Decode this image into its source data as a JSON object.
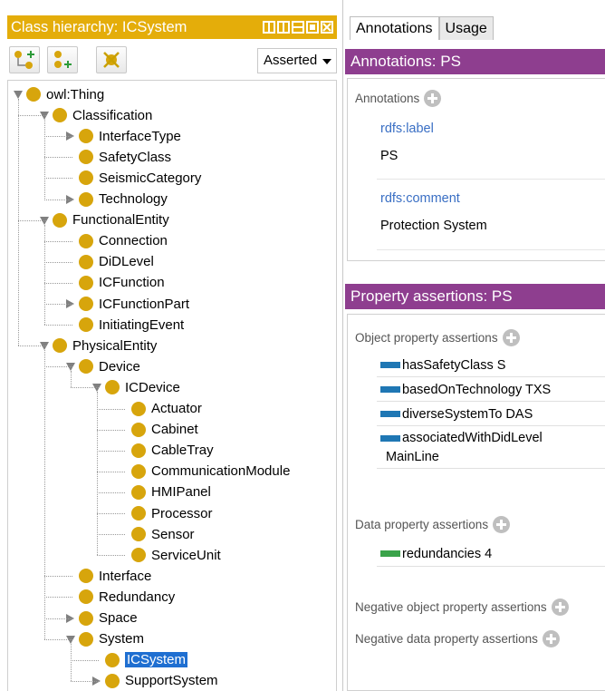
{
  "left": {
    "title": "Class hierarchy: ICSystem",
    "mode_select": "Asserted",
    "tree": [
      {
        "label": "owl:Thing",
        "depth": 0,
        "toggle": "open"
      },
      {
        "label": "Classification",
        "depth": 1,
        "toggle": "open"
      },
      {
        "label": "InterfaceType",
        "depth": 2,
        "toggle": "closed"
      },
      {
        "label": "SafetyClass",
        "depth": 2,
        "toggle": "none"
      },
      {
        "label": "SeismicCategory",
        "depth": 2,
        "toggle": "none"
      },
      {
        "label": "Technology",
        "depth": 2,
        "toggle": "closed"
      },
      {
        "label": "FunctionalEntity",
        "depth": 1,
        "toggle": "open"
      },
      {
        "label": "Connection",
        "depth": 2,
        "toggle": "none"
      },
      {
        "label": "DiDLevel",
        "depth": 2,
        "toggle": "none"
      },
      {
        "label": "ICFunction",
        "depth": 2,
        "toggle": "none"
      },
      {
        "label": "ICFunctionPart",
        "depth": 2,
        "toggle": "closed"
      },
      {
        "label": "InitiatingEvent",
        "depth": 2,
        "toggle": "none"
      },
      {
        "label": "PhysicalEntity",
        "depth": 1,
        "toggle": "open"
      },
      {
        "label": "Device",
        "depth": 2,
        "toggle": "open"
      },
      {
        "label": "ICDevice",
        "depth": 3,
        "toggle": "open"
      },
      {
        "label": "Actuator",
        "depth": 4,
        "toggle": "none"
      },
      {
        "label": "Cabinet",
        "depth": 4,
        "toggle": "none"
      },
      {
        "label": "CableTray",
        "depth": 4,
        "toggle": "none"
      },
      {
        "label": "CommunicationModule",
        "depth": 4,
        "toggle": "none"
      },
      {
        "label": "HMIPanel",
        "depth": 4,
        "toggle": "none"
      },
      {
        "label": "Processor",
        "depth": 4,
        "toggle": "none"
      },
      {
        "label": "Sensor",
        "depth": 4,
        "toggle": "none"
      },
      {
        "label": "ServiceUnit",
        "depth": 4,
        "toggle": "none"
      },
      {
        "label": "Interface",
        "depth": 2,
        "toggle": "none"
      },
      {
        "label": "Redundancy",
        "depth": 2,
        "toggle": "none"
      },
      {
        "label": "Space",
        "depth": 2,
        "toggle": "closed"
      },
      {
        "label": "System",
        "depth": 2,
        "toggle": "open"
      },
      {
        "label": "ICSystem",
        "depth": 3,
        "toggle": "none",
        "selected": true
      },
      {
        "label": "SupportSystem",
        "depth": 3,
        "toggle": "closed"
      }
    ]
  },
  "right": {
    "tabs": [
      "Annotations",
      "Usage"
    ],
    "annotations_header": "Annotations: PS",
    "annotations_label": "Annotations",
    "annotations": [
      {
        "property": "rdfs:label",
        "value": "PS"
      },
      {
        "property": "rdfs:comment",
        "value": "Protection System"
      }
    ],
    "property_header": "Property assertions: PS",
    "object_label": "Object property assertions",
    "object_assertions": [
      {
        "text": "hasSafetyClass  S"
      },
      {
        "text": "basedOnTechnology  TXS"
      },
      {
        "text": "diverseSystemTo  DAS"
      },
      {
        "text": "associatedWithDidLevel",
        "text2": "MainLine"
      }
    ],
    "data_label": "Data property assertions",
    "data_assertions": [
      {
        "text": "redundancies  4"
      }
    ],
    "neg_object_label": "Negative object property assertions",
    "neg_data_label": "Negative data property assertions"
  },
  "colors": {
    "class_header": "#e4ad0a",
    "section_header": "#8e3e8f",
    "class_dot": "#d7a50c",
    "object_prop": "#1f77b4",
    "data_prop": "#3aa34a",
    "selection": "#1f6fd1"
  }
}
